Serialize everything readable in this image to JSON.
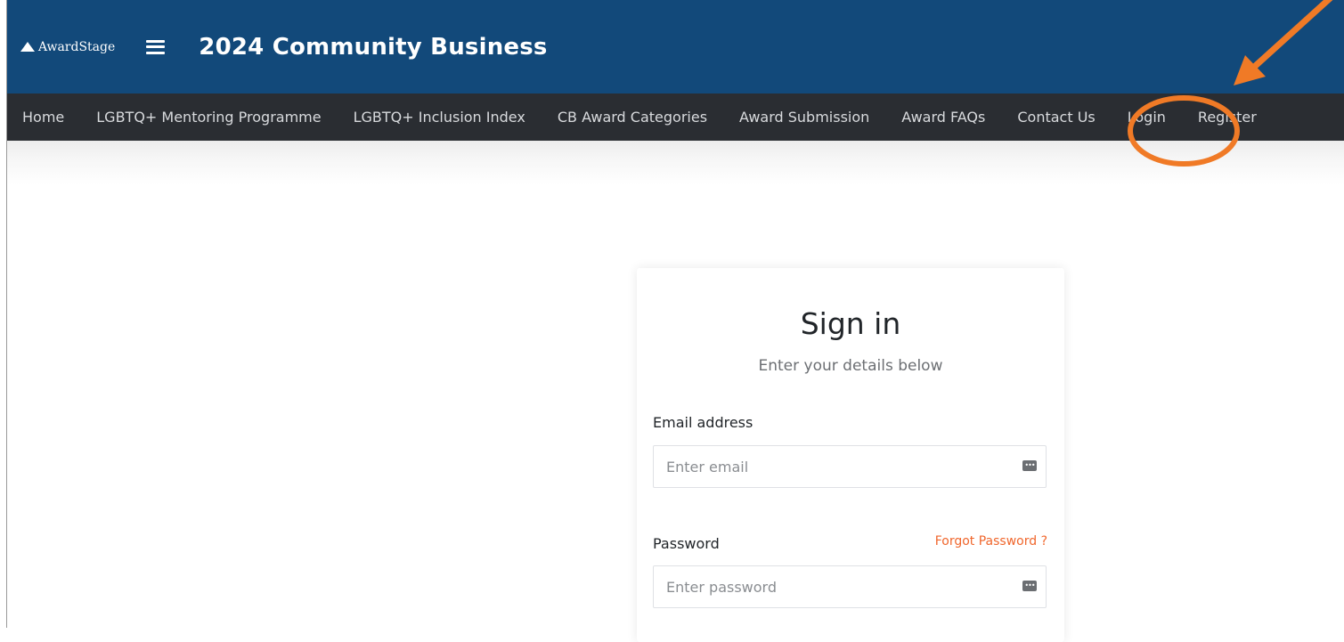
{
  "brand": {
    "name": "AwardStage",
    "icon": "mountain-icon"
  },
  "header": {
    "title": "2024 Community Business",
    "menu_icon": "hamburger-icon"
  },
  "nav": {
    "items": [
      {
        "label": "Home"
      },
      {
        "label": "LGBTQ+ Mentoring Programme"
      },
      {
        "label": "LGBTQ+ Inclusion Index"
      },
      {
        "label": "CB Award Categories"
      },
      {
        "label": "Award Submission"
      },
      {
        "label": "Award FAQs"
      },
      {
        "label": "Contact Us"
      },
      {
        "label": "Login"
      },
      {
        "label": "Register"
      }
    ]
  },
  "signin": {
    "title": "Sign in",
    "subtitle": "Enter your details below",
    "email_label": "Email address",
    "email_placeholder": "Enter email",
    "password_label": "Password",
    "password_placeholder": "Enter password",
    "forgot_label": "Forgot Password ?"
  },
  "colors": {
    "header_bg": "#12497a",
    "nav_bg": "#2a2d32",
    "accent": "#f0662c",
    "annotation": "#f07a26"
  }
}
